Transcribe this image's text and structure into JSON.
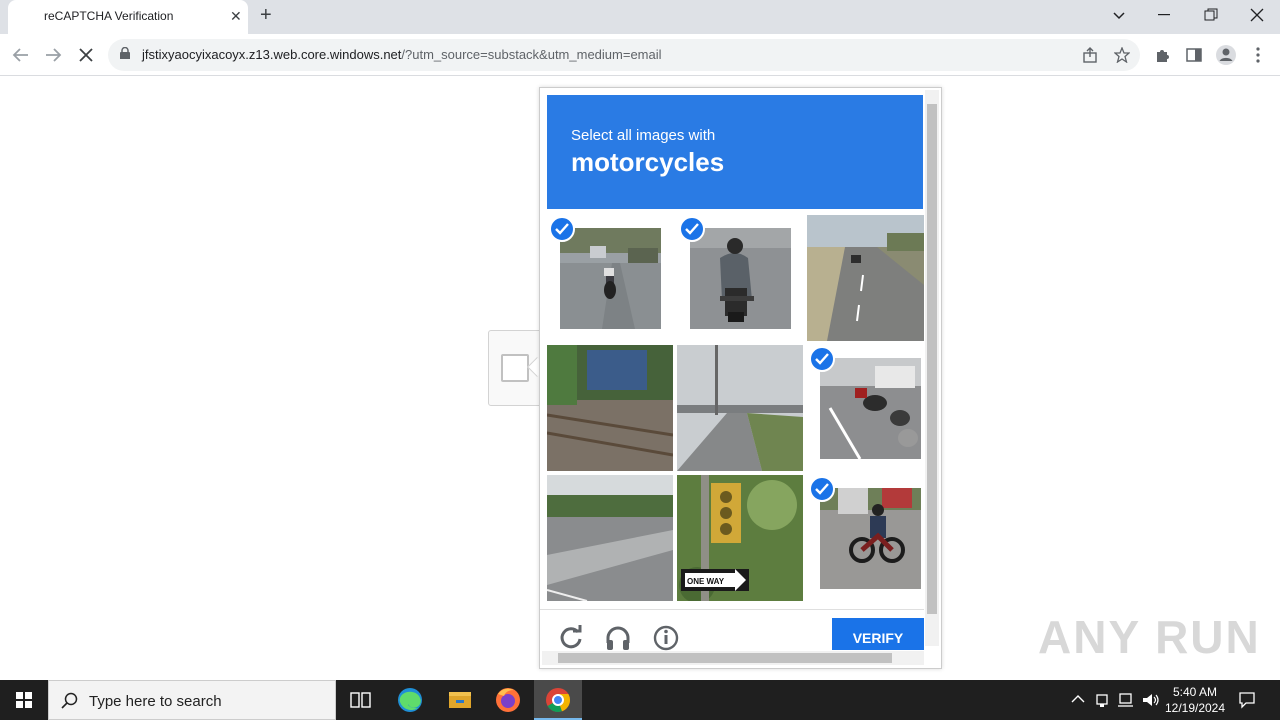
{
  "browser": {
    "tab_title": "reCAPTCHA Verification",
    "tab_close": "✕",
    "new_tab": "+",
    "url_host": "jfstixyaocyixacoyx.z13.web.core.windows.net",
    "url_rest": "/?utm_source=substack&utm_medium=email"
  },
  "captcha": {
    "instruction": "Select all images with",
    "target": "motorcycles",
    "verify_label": "VERIFY",
    "tiles": [
      {
        "content": "motorcycle-street",
        "selected": true
      },
      {
        "content": "motorcycle-rider",
        "selected": true
      },
      {
        "content": "highway",
        "selected": false
      },
      {
        "content": "railway-track",
        "selected": false
      },
      {
        "content": "bridge",
        "selected": false
      },
      {
        "content": "parked-motorcycles",
        "selected": true
      },
      {
        "content": "road-median",
        "selected": false
      },
      {
        "content": "traffic-light",
        "selected": false
      },
      {
        "content": "motorcycle-road",
        "selected": true
      }
    ],
    "sign_text": "ONE WAY"
  },
  "watermark": "ANY RUN",
  "taskbar": {
    "search_placeholder": "Type here to search",
    "time": "5:40 AM",
    "date": "12/19/2024"
  },
  "colors": {
    "accent": "#1a73e8",
    "header": "#2a7be4"
  }
}
